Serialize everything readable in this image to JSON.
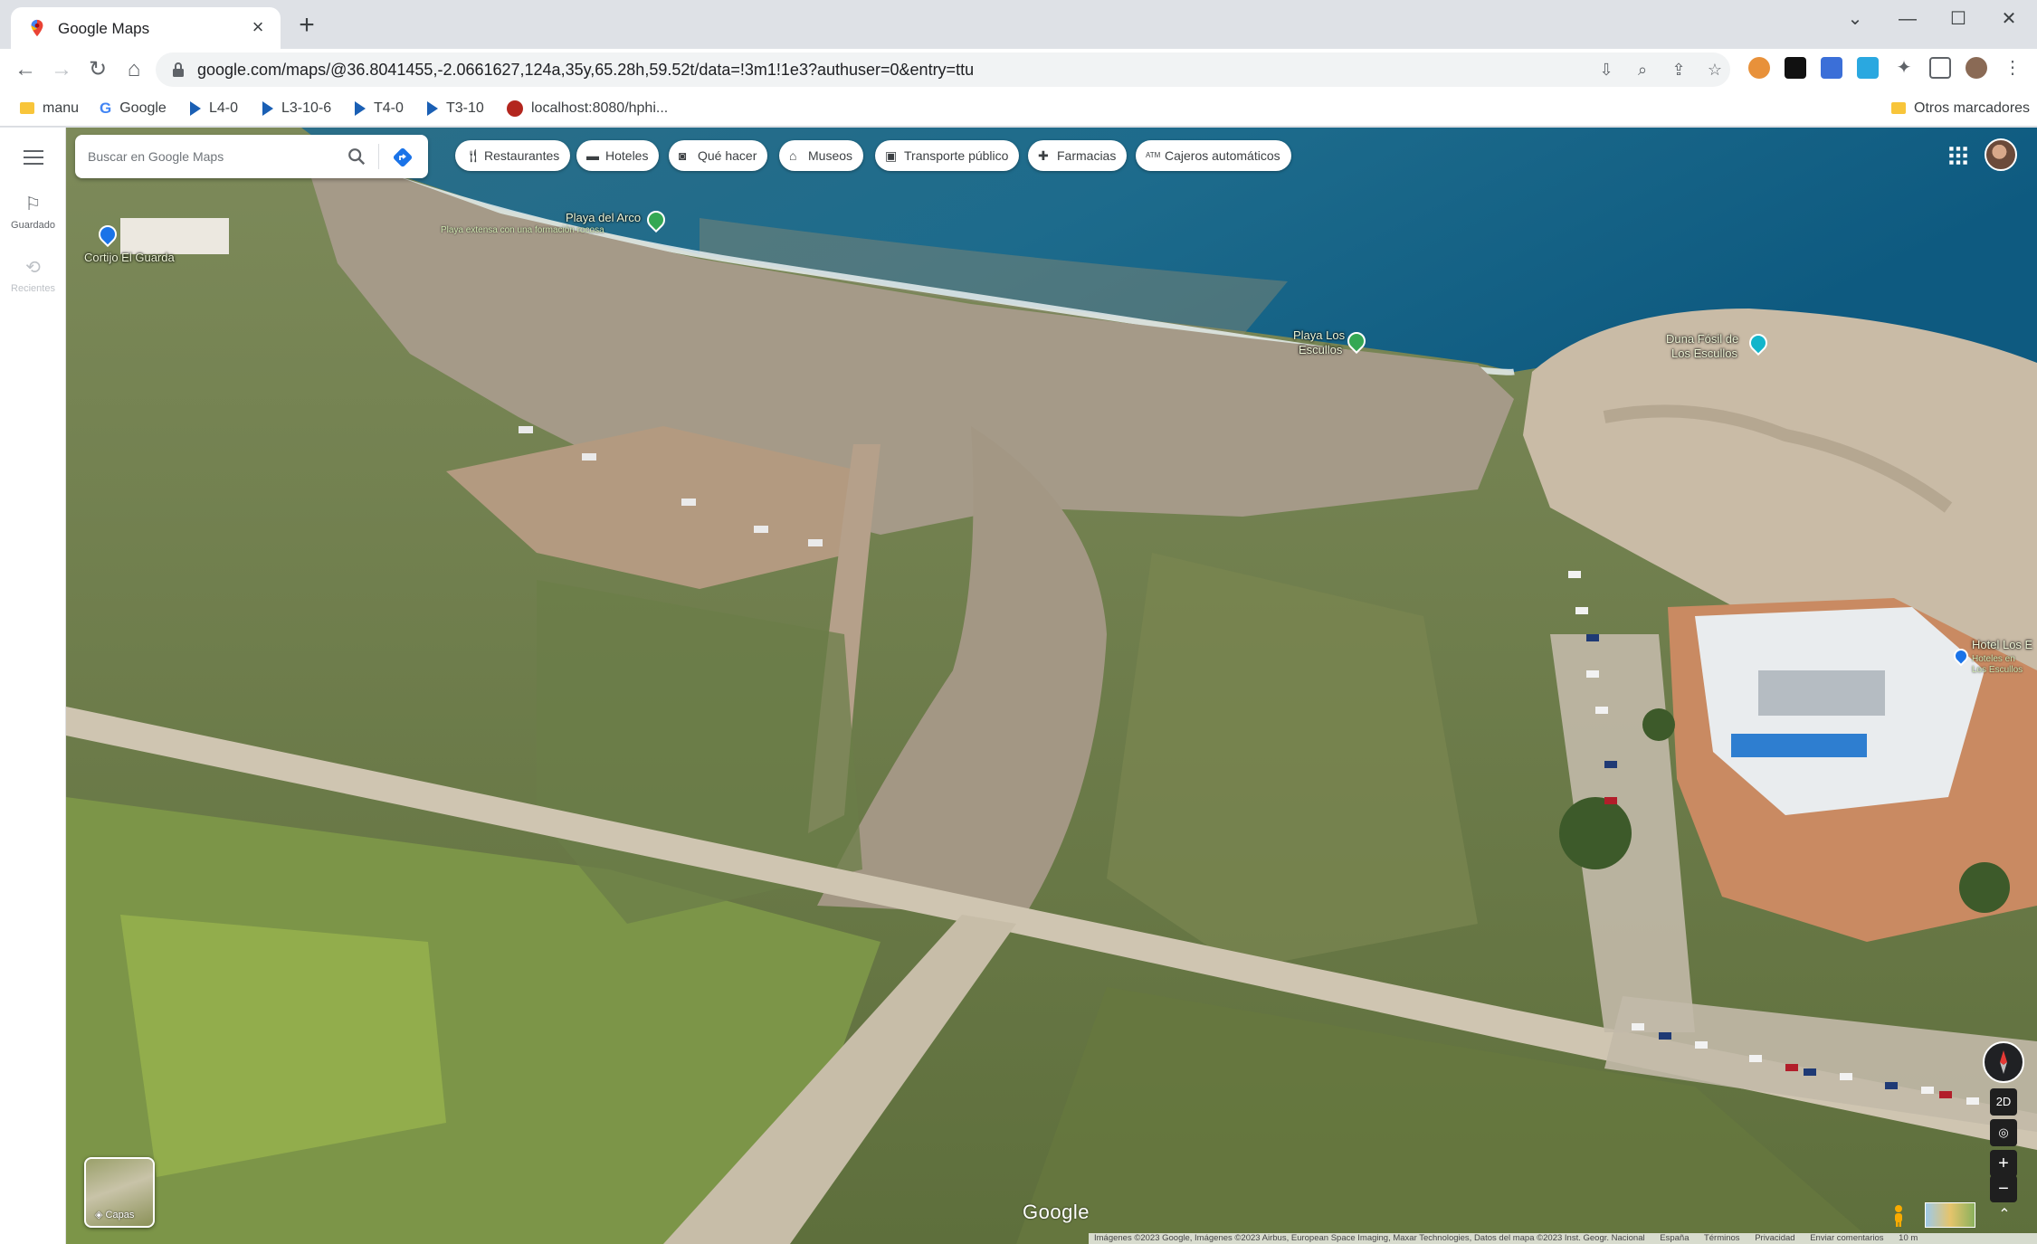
{
  "browser": {
    "tab_title": "Google Maps",
    "new_tab": "+",
    "url": "google.com/maps/@36.8041455,-2.0661627,124a,35y,65.28h,59.52t/data=!3m1!1e3?authuser=0&entry=ttu",
    "window_controls": {
      "chevron": "⌄",
      "minimize": "—",
      "maximize": "☐",
      "close": "✕"
    }
  },
  "bookmarks": {
    "items": [
      {
        "label": "manu",
        "icon": "folder-icon"
      },
      {
        "label": "Google",
        "icon": "google-icon"
      },
      {
        "label": "L4-0",
        "icon": "play-icon"
      },
      {
        "label": "L3-10-6",
        "icon": "play-icon"
      },
      {
        "label": "T4-0",
        "icon": "play-icon"
      },
      {
        "label": "T3-10",
        "icon": "play-icon"
      },
      {
        "label": "localhost:8080/hphi...",
        "icon": "site-icon"
      }
    ],
    "other": "Otros marcadores"
  },
  "sidebar": {
    "saved": "Guardado",
    "recent": "Recientes"
  },
  "search": {
    "placeholder": "Buscar en Google Maps"
  },
  "chips": [
    {
      "label": "Restaurantes",
      "icon": "fork-knife-icon"
    },
    {
      "label": "Hoteles",
      "icon": "bed-icon"
    },
    {
      "label": "Qué hacer",
      "icon": "camera-icon"
    },
    {
      "label": "Museos",
      "icon": "museum-icon"
    },
    {
      "label": "Transporte público",
      "icon": "bus-icon"
    },
    {
      "label": "Farmacias",
      "icon": "pharmacy-icon"
    },
    {
      "label": "Cajeros automáticos",
      "icon": "atm-icon"
    }
  ],
  "places": {
    "cortijo": "Cortijo El Guarda",
    "playa_arco": "Playa del Arco",
    "playa_arco_sub": "Playa extensa con una formación rocosa",
    "playa_escullos_1": "Playa Los",
    "playa_escullos_2": "Escullos",
    "duna_1": "Duna Fósil de",
    "duna_2": "Los Escullos",
    "hotel_1": "Hotel Los E",
    "hotel_2": "Hoteles en",
    "hotel_3": "Los Escullos"
  },
  "controls": {
    "layers": "Capas",
    "mode_2d": "2D",
    "zoom_in": "+",
    "zoom_out": "−",
    "expand": "⌃"
  },
  "footer": {
    "logo": "Google",
    "imagery": "Imágenes ©2023 Google, Imágenes ©2023 Airbus, European Space Imaging, Maxar Technologies, Datos del mapa ©2023 Inst. Geogr. Nacional",
    "country": "España",
    "terms": "Términos",
    "privacy": "Privacidad",
    "feedback": "Enviar comentarios",
    "scale": "10 m"
  },
  "colors": {
    "accent": "#1a73e8",
    "pin_green": "#34a853",
    "pin_teal": "#12b5cb"
  }
}
